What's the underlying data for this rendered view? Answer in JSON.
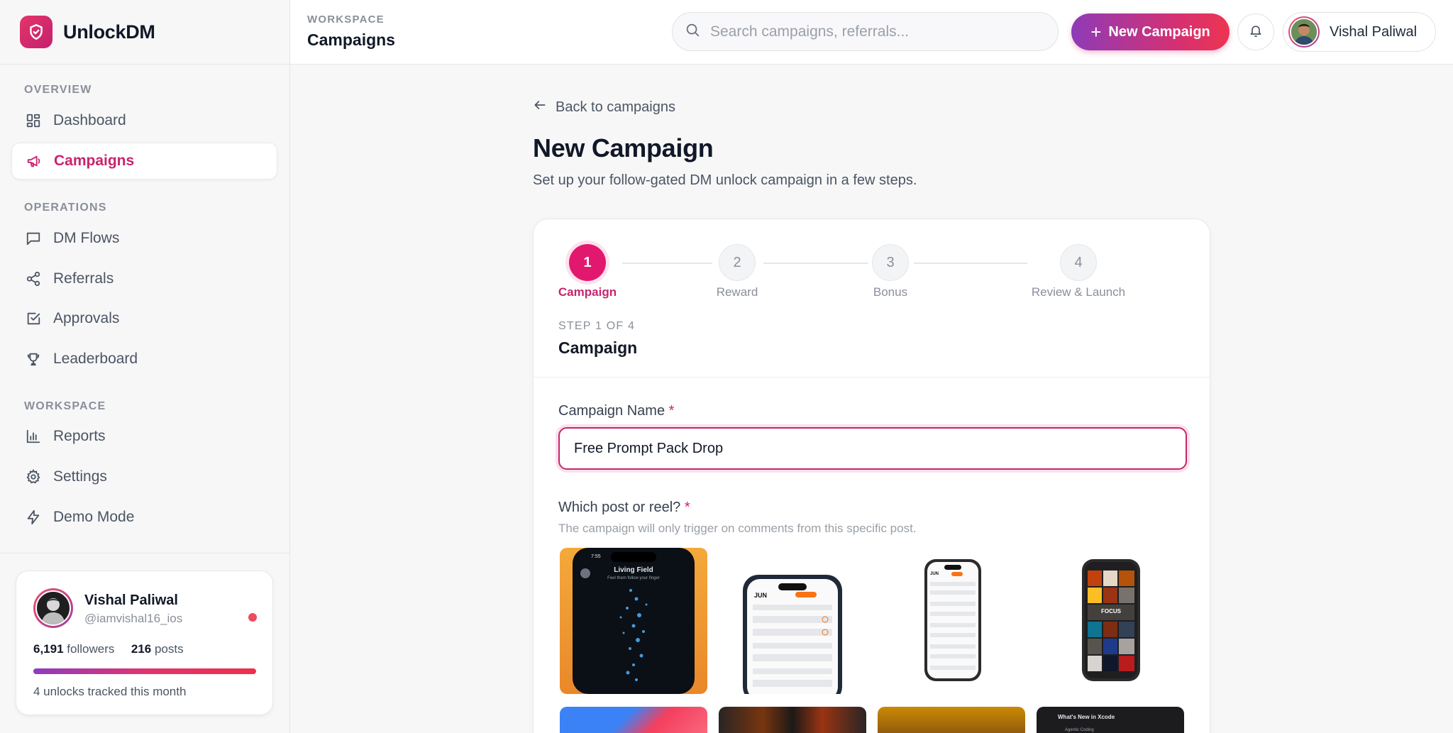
{
  "app": {
    "name": "UnlockDM"
  },
  "sidebar": {
    "sections": [
      {
        "label": "OVERVIEW"
      },
      {
        "label": "OPERATIONS"
      },
      {
        "label": "WORKSPACE"
      }
    ],
    "items": [
      {
        "label": "Dashboard",
        "icon": "grid-icon"
      },
      {
        "label": "Campaigns",
        "icon": "megaphone-icon",
        "active": true
      },
      {
        "label": "DM Flows",
        "icon": "message-icon"
      },
      {
        "label": "Referrals",
        "icon": "share-icon"
      },
      {
        "label": "Approvals",
        "icon": "check-square-icon"
      },
      {
        "label": "Leaderboard",
        "icon": "trophy-icon"
      },
      {
        "label": "Reports",
        "icon": "bar-chart-icon"
      },
      {
        "label": "Settings",
        "icon": "gear-icon"
      },
      {
        "label": "Demo Mode",
        "icon": "lightning-icon"
      }
    ],
    "profile": {
      "name": "Vishal Paliwal",
      "handle": "@iamvishal16_ios",
      "followers_count": "6,191",
      "followers_label": "followers",
      "posts_count": "216",
      "posts_label": "posts",
      "footer": "4 unlocks tracked this month"
    }
  },
  "header": {
    "breadcrumb_label": "WORKSPACE",
    "breadcrumb_title": "Campaigns",
    "search_placeholder": "Search campaigns, referrals...",
    "new_campaign_label": "New Campaign",
    "user_name": "Vishal Paliwal"
  },
  "main": {
    "back_label": "Back to campaigns",
    "title": "New Campaign",
    "subtitle": "Set up your follow-gated DM unlock campaign in a few steps.",
    "steps": [
      {
        "number": "1",
        "label": "Campaign",
        "active": true
      },
      {
        "number": "2",
        "label": "Reward"
      },
      {
        "number": "3",
        "label": "Bonus"
      },
      {
        "number": "4",
        "label": "Review & Launch"
      }
    ],
    "step_counter": "STEP 1 OF 4",
    "step_title": "Campaign",
    "campaign_name_label": "Campaign Name",
    "required_mark": "*",
    "campaign_name_value": "Free Prompt Pack Drop",
    "post_label": "Which post or reel?",
    "post_help": "The campaign will only trigger on comments from this specific post.",
    "thumbnails": [
      {
        "caption": "Living Field",
        "subcaption": "Feel them follow your finger",
        "time": "7:55"
      },
      {
        "caption": "JUN"
      },
      {
        "caption": "JUN"
      },
      {
        "caption": "FOCUS"
      },
      {
        "caption": ""
      },
      {
        "caption": ""
      },
      {
        "caption": ""
      },
      {
        "caption": "What's New in Xcode",
        "subcaption": "Agentic Coding"
      }
    ]
  },
  "colors": {
    "accent": "#e2186f",
    "accent_text": "#c8246e",
    "gradient_start": "#8e3bb8",
    "gradient_end": "#ec3550"
  }
}
